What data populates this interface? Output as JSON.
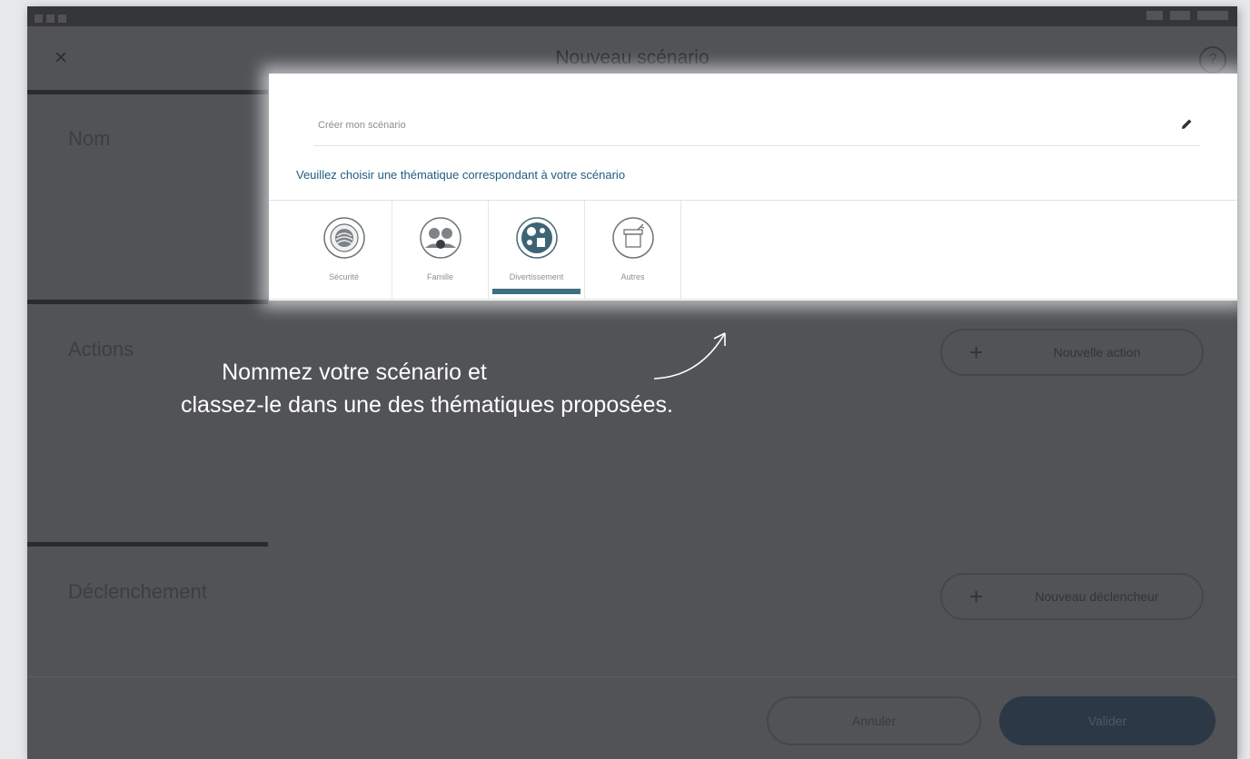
{
  "header": {
    "title": "Nouveau scénario",
    "close_glyph": "×",
    "help_glyph": "?"
  },
  "sections": {
    "name": "Nom",
    "actions": "Actions",
    "trigger": "Déclenchement"
  },
  "name_field": {
    "placeholder": "Créer mon scénario",
    "value": ""
  },
  "theme_prompt": "Veuillez choisir une thématique correspondant à votre scénario",
  "themes": [
    {
      "label": "Sécurité",
      "icon": "security-icon",
      "selected": false
    },
    {
      "label": "Famille",
      "icon": "family-icon",
      "selected": false
    },
    {
      "label": "Divertissement",
      "icon": "entertainment-icon",
      "selected": true
    },
    {
      "label": "Autres",
      "icon": "other-icon",
      "selected": false
    }
  ],
  "buttons": {
    "new_action": "Nouvelle action",
    "new_trigger": "Nouveau déclencheur",
    "cancel": "Annuler",
    "validate": "Valider",
    "plus_glyph": "+"
  },
  "callout": {
    "line1": "Nommez votre scénario et",
    "line2": "classez-le dans une des thématiques proposées."
  },
  "colors": {
    "accent": "#3d7081",
    "prompt_text": "#1f5d80",
    "overlay": "#515357",
    "validate_bg": "#2c3845"
  }
}
